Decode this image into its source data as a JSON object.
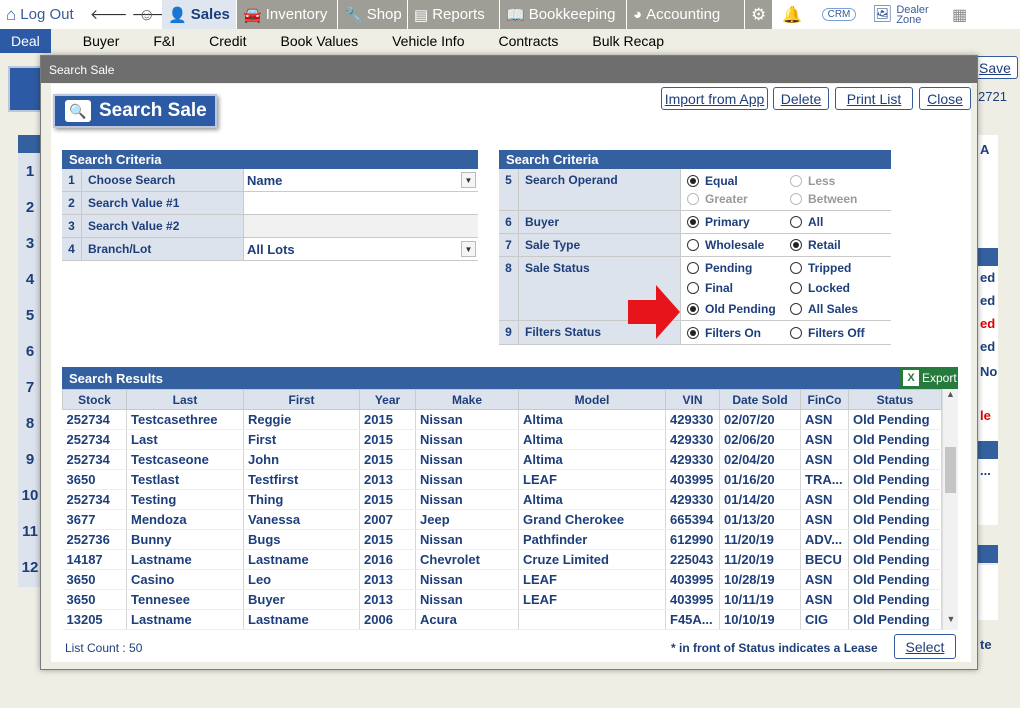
{
  "topbar": {
    "logout": "Log Out",
    "sales": "Sales",
    "inventory": "Inventory",
    "shop": "Shop",
    "reports": "Reports",
    "bookkeeping": "Bookkeeping",
    "accounting": "Accounting",
    "crm": "CRM",
    "dealer_zone": "Dealer Zone"
  },
  "subnav": [
    "Deal",
    "Buyer",
    "F&I",
    "Credit",
    "Book Values",
    "Vehicle Info",
    "Contracts",
    "Bulk Recap"
  ],
  "bg": {
    "save": "Save",
    "num": "2721",
    "left_rows": [
      "1",
      "2",
      "3",
      "4",
      "5",
      "6",
      "7",
      "8",
      "9",
      "10",
      "11",
      "12"
    ],
    "right_texts": [
      "A",
      "ed",
      "ed",
      "ed",
      "ed",
      "No",
      "le",
      "...",
      "te"
    ]
  },
  "modal": {
    "title": "Search Sale",
    "heading": "Search Sale",
    "buttons": {
      "import": "Import from App",
      "delete": "Delete",
      "print": "Print List",
      "close": "Close"
    }
  },
  "criteria_left": {
    "title": "Search Criteria",
    "rows": [
      {
        "num": "1",
        "label": "Choose Search",
        "value": "Name"
      },
      {
        "num": "2",
        "label": "Search Value #1",
        "value": ""
      },
      {
        "num": "3",
        "label": "Search Value #2",
        "value": ""
      },
      {
        "num": "4",
        "label": "Branch/Lot",
        "value": "All Lots"
      }
    ]
  },
  "criteria_right": {
    "title": "Search Criteria",
    "rows": [
      {
        "num": "5",
        "label": "Search Operand",
        "opts": [
          "Equal",
          "Less",
          "Greater",
          "Between"
        ]
      },
      {
        "num": "6",
        "label": "Buyer",
        "opts": [
          "Primary",
          "All"
        ]
      },
      {
        "num": "7",
        "label": "Sale Type",
        "opts": [
          "Wholesale",
          "Retail"
        ]
      },
      {
        "num": "8",
        "label": "Sale Status",
        "opts": [
          "Pending",
          "Tripped",
          "Final",
          "Locked",
          "Old Pending",
          "All Sales"
        ]
      },
      {
        "num": "9",
        "label": "Filters Status",
        "opts": [
          "Filters On",
          "Filters Off"
        ]
      }
    ]
  },
  "results": {
    "title": "Search Results",
    "export": "Export",
    "columns": [
      "Stock",
      "Last",
      "First",
      "Year",
      "Make",
      "Model",
      "VIN",
      "Date Sold",
      "FinCo",
      "Status"
    ],
    "rows": [
      [
        "252734",
        "Testcasethree",
        "Reggie",
        "2015",
        "Nissan",
        "Altima",
        "429330",
        "02/07/20",
        "ASN",
        "Old Pending"
      ],
      [
        "252734",
        "Last",
        "First",
        "2015",
        "Nissan",
        "Altima",
        "429330",
        "02/06/20",
        "ASN",
        "Old Pending"
      ],
      [
        "252734",
        "Testcaseone",
        "John",
        "2015",
        "Nissan",
        "Altima",
        "429330",
        "02/04/20",
        "ASN",
        "Old Pending"
      ],
      [
        "3650",
        "Testlast",
        "Testfirst",
        "2013",
        "Nissan",
        "LEAF",
        "403995",
        "01/16/20",
        "TRA...",
        "Old Pending"
      ],
      [
        "252734",
        "Testing",
        "Thing",
        "2015",
        "Nissan",
        "Altima",
        "429330",
        "01/14/20",
        "ASN",
        "Old Pending"
      ],
      [
        "3677",
        "Mendoza",
        "Vanessa",
        "2007",
        "Jeep",
        "Grand Cherokee",
        "665394",
        "01/13/20",
        "ASN",
        "Old Pending"
      ],
      [
        "252736",
        "Bunny",
        "Bugs",
        "2015",
        "Nissan",
        "Pathfinder",
        "612990",
        "11/20/19",
        "ADV...",
        "Old Pending"
      ],
      [
        "14187",
        "Lastname",
        "Lastname",
        "2016",
        "Chevrolet",
        "Cruze Limited",
        "225043",
        "11/20/19",
        "BECU",
        "Old Pending"
      ],
      [
        "3650",
        "Casino",
        "Leo",
        "2013",
        "Nissan",
        "LEAF",
        "403995",
        "10/28/19",
        "ASN",
        "Old Pending"
      ],
      [
        "3650",
        "Tennesee",
        "Buyer",
        "2013",
        "Nissan",
        "LEAF",
        "403995",
        "10/11/19",
        "ASN",
        "Old Pending"
      ],
      [
        "13205",
        "Lastname",
        "Lastname",
        "2006",
        "Acura",
        "",
        "F45A...",
        "10/10/19",
        "CIG",
        "Old Pending"
      ]
    ],
    "list_count": "List Count : 50",
    "lease_note": "* in front of Status indicates a Lease",
    "select": "Select"
  },
  "colors": {
    "header_blue": "#35609f",
    "arrow_red": "#e8141c",
    "label_bg": "#dde3ec"
  }
}
